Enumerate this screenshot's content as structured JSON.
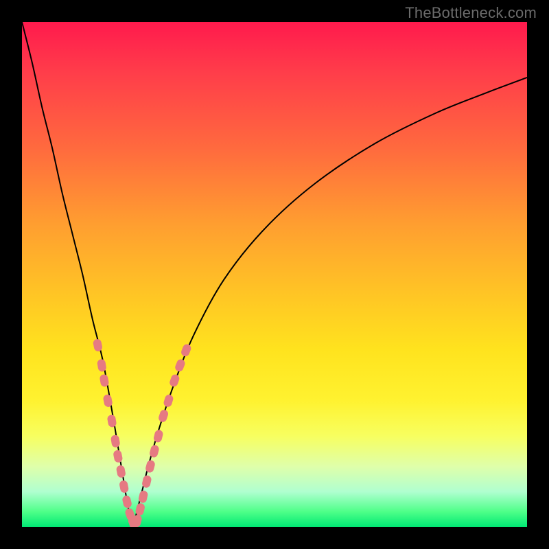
{
  "watermark": "TheBottleneck.com",
  "colors": {
    "frame": "#000000",
    "curve": "#000000",
    "bead": "#e67a82"
  },
  "chart_data": {
    "type": "line",
    "title": "",
    "xlabel": "",
    "ylabel": "",
    "xlim": [
      0,
      100
    ],
    "ylim": [
      0,
      100
    ],
    "notes": "V-shaped bottleneck curve over vertical rainbow gradient. Curve minimum near x≈22, y≈0. Pink bead markers cluster on both curve branches near the minimum (roughly y < 25).",
    "series": [
      {
        "name": "left-branch",
        "x": [
          0,
          2,
          4,
          6,
          8,
          10,
          12,
          14,
          16,
          18,
          19,
          20,
          21,
          22
        ],
        "y": [
          100,
          92,
          83,
          75,
          66,
          58,
          50,
          41,
          33,
          22,
          16,
          10,
          4,
          0
        ]
      },
      {
        "name": "right-branch",
        "x": [
          22,
          23,
          24,
          25,
          27,
          30,
          34,
          40,
          48,
          58,
          70,
          82,
          92,
          100
        ],
        "y": [
          0,
          4,
          8,
          12,
          19,
          28,
          38,
          49,
          59,
          68,
          76,
          82,
          86,
          89
        ]
      }
    ],
    "markers": {
      "left_branch_beads": [
        {
          "x": 15,
          "y": 36
        },
        {
          "x": 15.8,
          "y": 32
        },
        {
          "x": 16.3,
          "y": 29
        },
        {
          "x": 17,
          "y": 25
        },
        {
          "x": 17.8,
          "y": 21
        },
        {
          "x": 18.5,
          "y": 17
        },
        {
          "x": 19,
          "y": 14
        },
        {
          "x": 19.6,
          "y": 11
        },
        {
          "x": 20.2,
          "y": 8
        },
        {
          "x": 20.8,
          "y": 5
        },
        {
          "x": 21.4,
          "y": 2.5
        },
        {
          "x": 22,
          "y": 0.8
        }
      ],
      "right_branch_beads": [
        {
          "x": 22.8,
          "y": 1.2
        },
        {
          "x": 23.4,
          "y": 3.5
        },
        {
          "x": 24,
          "y": 6
        },
        {
          "x": 24.7,
          "y": 9
        },
        {
          "x": 25.4,
          "y": 12
        },
        {
          "x": 26.2,
          "y": 15
        },
        {
          "x": 27,
          "y": 18
        },
        {
          "x": 28,
          "y": 22
        },
        {
          "x": 29,
          "y": 25
        },
        {
          "x": 30.2,
          "y": 29
        },
        {
          "x": 31.3,
          "y": 32
        },
        {
          "x": 32.5,
          "y": 35
        }
      ]
    }
  }
}
